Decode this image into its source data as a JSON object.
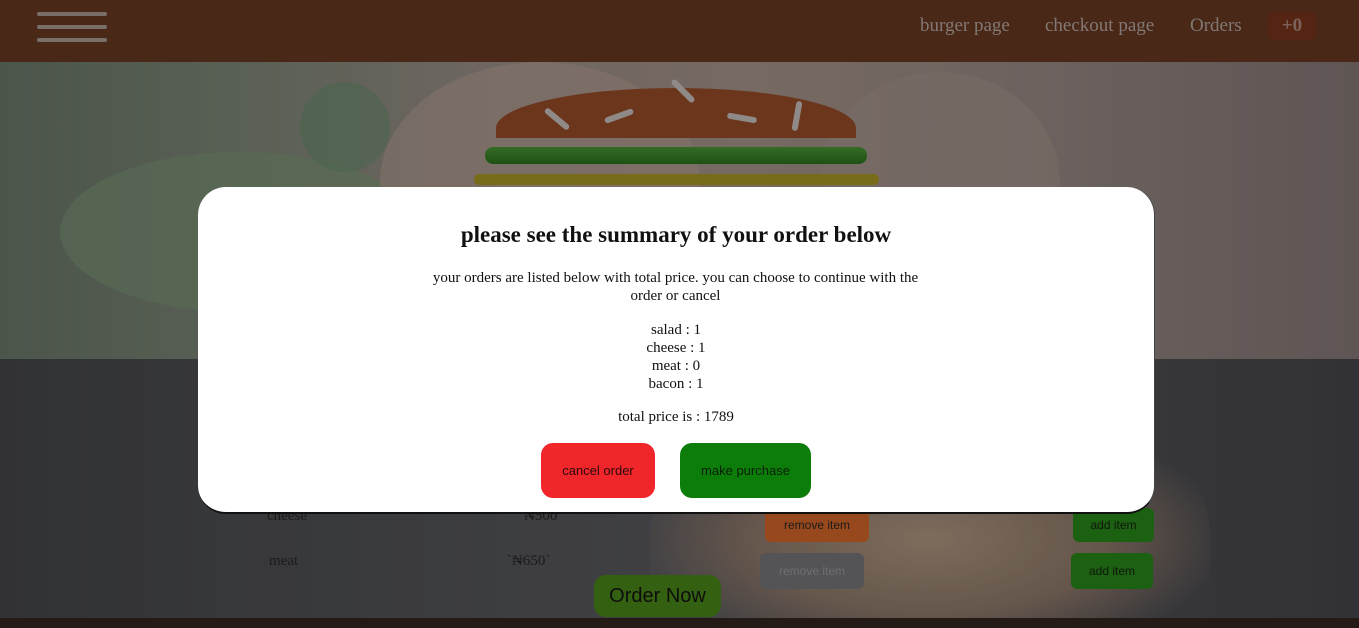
{
  "nav": {
    "links": [
      "burger page",
      "checkout page",
      "Orders"
    ],
    "cart_count": "+0"
  },
  "controls": {
    "rows": [
      {
        "label": "cheese",
        "price": "`₦500`",
        "remove_label": "remove item",
        "add_label": "add item"
      },
      {
        "label": "meat",
        "price": "`₦650`",
        "remove_label": "remove item",
        "add_label": "add item"
      }
    ],
    "order_now": "Order Now"
  },
  "modal": {
    "title": "please see the summary of your order below",
    "description": "your orders are listed below with total price. you can choose to continue with the order or cancel",
    "items": [
      "salad : 1",
      "cheese : 1",
      "meat : 0",
      "bacon : 1"
    ],
    "total": "total price is : 1789",
    "cancel_label": "cancel order",
    "purchase_label": "make purchase"
  },
  "colors": {
    "navbar": "#5d2f1a",
    "cancel": "#f0262a",
    "purchase": "#0d7d0a",
    "add": "#1f7a10",
    "remove": "#c55a20"
  }
}
